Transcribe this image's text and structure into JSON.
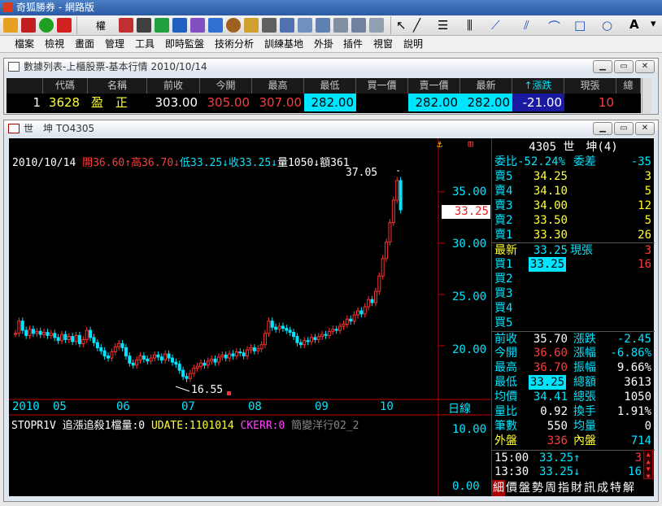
{
  "app": {
    "title": "奇狐勝券 - 網路版"
  },
  "menu": [
    "檔案",
    "檢視",
    "畫面",
    "管理",
    "工具",
    "即時監盤",
    "技術分析",
    "訓練基地",
    "外掛",
    "插件",
    "視窗",
    "說明"
  ],
  "toolbar_label": "權",
  "list_window": {
    "title": "數據列表-上櫃股票-基本行情 2010/10/14",
    "headers": [
      "代碼",
      "名稱",
      "前收",
      "今開",
      "最高",
      "最低",
      "買一價",
      "賣一價",
      "最新",
      "↑漲跌",
      "現張",
      "總"
    ],
    "row": {
      "index": "1",
      "code": "3628",
      "name": "盈　正",
      "prev": "303.00",
      "open": "305.00",
      "high": "307.00",
      "low": "282.00",
      "bid": "",
      "ask": "282.00",
      "last": "282.00",
      "change": "-21.00",
      "vol": "10",
      "total": ""
    }
  },
  "chart_window": {
    "title": "世　坤 TO4305"
  },
  "chart_header": {
    "name": "世　坤",
    "date": "2010/10/14",
    "open": "開36.60↑",
    "high": "高36.70↓",
    "low": "低33.25↓",
    "close": "收33.25↓",
    "volume": "量1050↓",
    "amount": "額361"
  },
  "chart_data": {
    "type": "candlestick",
    "x_labels": [
      "2010",
      "05",
      "06",
      "07",
      "08",
      "09",
      "10"
    ],
    "y_ticks": [
      "35.00",
      "30.00",
      "25.00",
      "20.00"
    ],
    "ylim": [
      15,
      38
    ],
    "max_label": "37.05",
    "min_label": "16.55",
    "current": "33.25",
    "closes": [
      21.2,
      22.4,
      21.5,
      21.0,
      21.6,
      21.2,
      21.4,
      21.1,
      21.3,
      21.0,
      21.2,
      20.8,
      20.5,
      21.1,
      20.6,
      20.9,
      20.4,
      21.0,
      20.2,
      20.6,
      21.5,
      20.8,
      20.3,
      19.8,
      19.5,
      19.0,
      18.8,
      19.4,
      19.9,
      20.2,
      19.8,
      19.0,
      18.3,
      18.1,
      18.6,
      19.0,
      18.7,
      18.5,
      18.8,
      19.1,
      18.9,
      18.6,
      19.2,
      18.8,
      18.4,
      18.2,
      17.6,
      17.0,
      16.8,
      17.3,
      17.8,
      18.0,
      18.3,
      18.1,
      18.5,
      18.7,
      18.4,
      18.9,
      19.1,
      18.8,
      19.2,
      19.0,
      19.4,
      19.3,
      19.0,
      19.6,
      19.8,
      19.5,
      19.7,
      20.1,
      21.2,
      22.4,
      21.8,
      21.6,
      21.9,
      21.7,
      21.5,
      21.3,
      20.9,
      20.3,
      20.1,
      20.5,
      20.4,
      20.8,
      20.6,
      20.9,
      21.1,
      21.0,
      21.4,
      21.6,
      21.5,
      21.9,
      22.1,
      22.6,
      22.4,
      23.0,
      23.4,
      23.1,
      23.8,
      24.5,
      24.2,
      25.3,
      26.8,
      28.5,
      30.1,
      32.0,
      34.2,
      36.1,
      33.25
    ],
    "volume_label": "STOPR1V",
    "volume_y": [
      "10.00",
      "0.00"
    ]
  },
  "indicator": {
    "label1": "STOPR1V",
    "label2": "追漲追殺1檔量:0",
    "label3": "UDATE:1101014",
    "label4": "CKERR:0",
    "label5": "簡變洋行02_2",
    "period": "日線"
  },
  "right_panel": {
    "header": "4305 世　坤(4)",
    "ratio_label": "委比",
    "ratio_value": "-52.24%",
    "diff_label": "委差",
    "diff_value": "-35",
    "asks": [
      {
        "label": "賣5",
        "price": "34.25",
        "qty": "3"
      },
      {
        "label": "賣4",
        "price": "34.10",
        "qty": "5"
      },
      {
        "label": "賣3",
        "price": "34.00",
        "qty": "12"
      },
      {
        "label": "賣2",
        "price": "33.50",
        "qty": "5"
      },
      {
        "label": "賣1",
        "price": "33.30",
        "qty": "26"
      }
    ],
    "last_label": "最新",
    "last_price": "33.25",
    "cur_label": "現張",
    "cur_qty": "3",
    "bids": [
      {
        "label": "買1",
        "price": "33.25",
        "qty": "16"
      },
      {
        "label": "買2",
        "price": "",
        "qty": ""
      },
      {
        "label": "買3",
        "price": "",
        "qty": ""
      },
      {
        "label": "買4",
        "price": "",
        "qty": ""
      },
      {
        "label": "買5",
        "price": "",
        "qty": ""
      }
    ],
    "stats": [
      {
        "l1": "前收",
        "v1": "35.70",
        "l2": "漲跌",
        "v2": "-2.45"
      },
      {
        "l1": "今開",
        "v1": "36.60",
        "l2": "漲幅",
        "v2": "-6.86%"
      },
      {
        "l1": "最高",
        "v1": "36.70",
        "l2": "振幅",
        "v2": "9.66%"
      },
      {
        "l1": "最低",
        "v1": "33.25",
        "l2": "總額",
        "v2": "3613"
      },
      {
        "l1": "均價",
        "v1": "34.41",
        "l2": "總張",
        "v2": "1050"
      },
      {
        "l1": "量比",
        "v1": "0.92",
        "l2": "換手",
        "v2": "1.91%"
      },
      {
        "l1": "筆數",
        "v1": "550",
        "l2": "均量",
        "v2": "0"
      },
      {
        "l1": "外盤",
        "v1": "336",
        "l2": "內盤",
        "v2": "714"
      }
    ],
    "ticks": [
      {
        "time": "15:00",
        "price": "33.25↑",
        "qty": "3"
      },
      {
        "time": "13:30",
        "price": "33.25↓",
        "qty": "16"
      }
    ],
    "tabs": [
      "細",
      "價",
      "盤",
      "勢",
      "周",
      "指",
      "財",
      "訊",
      "成",
      "特",
      "解"
    ]
  }
}
